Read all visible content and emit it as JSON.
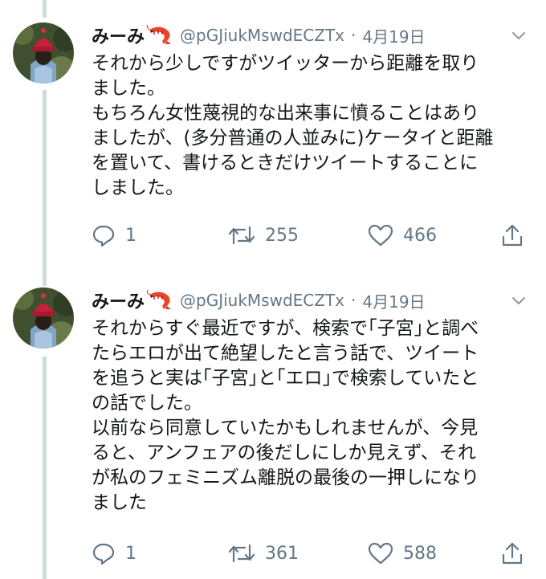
{
  "tweets": [
    {
      "name": "みーみ",
      "handle": "@pGJiukMswdECZTx",
      "separator": "·",
      "date": "4月19日",
      "lines": [
        "それから少しですがツイッターから距離を取り",
        "ました。",
        "もちろん女性蔑視的な出来事に憤ることはあり",
        "ましたが、(多分普通の人並みに)ケータイと距離",
        "を置いて、書けるときだけツイートすることに",
        "しました。"
      ],
      "replies": "1",
      "retweets": "255",
      "likes": "466"
    },
    {
      "name": "みーみ",
      "handle": "@pGJiukMswdECZTx",
      "separator": "·",
      "date": "4月19日",
      "lines": [
        "それからすぐ最近ですが、検索で｢子宮｣と調べ",
        "たらエロが出て絶望したと言う話で、ツイート",
        "を追うと実は｢子宮｣と｢エロ｣で検索していたと",
        "の話でした。",
        "以前なら同意していたかもしれませんが、今見",
        "ると、アンフェアの後だしにしか見えず、それ",
        "が私のフェミニズム離脱の最後の一押しになり",
        "ました"
      ],
      "replies": "1",
      "retweets": "361",
      "likes": "588"
    }
  ],
  "icons": {
    "reply": "reply-icon",
    "retweet": "retweet-icon",
    "like": "heart-icon",
    "share": "share-icon",
    "menu": "chevron-down-icon",
    "emoji": "shrimp-emoji"
  },
  "colors": {
    "text": "#14171a",
    "secondary": "#657786",
    "thread_line": "#cfd9de",
    "background": "#ffffff"
  }
}
